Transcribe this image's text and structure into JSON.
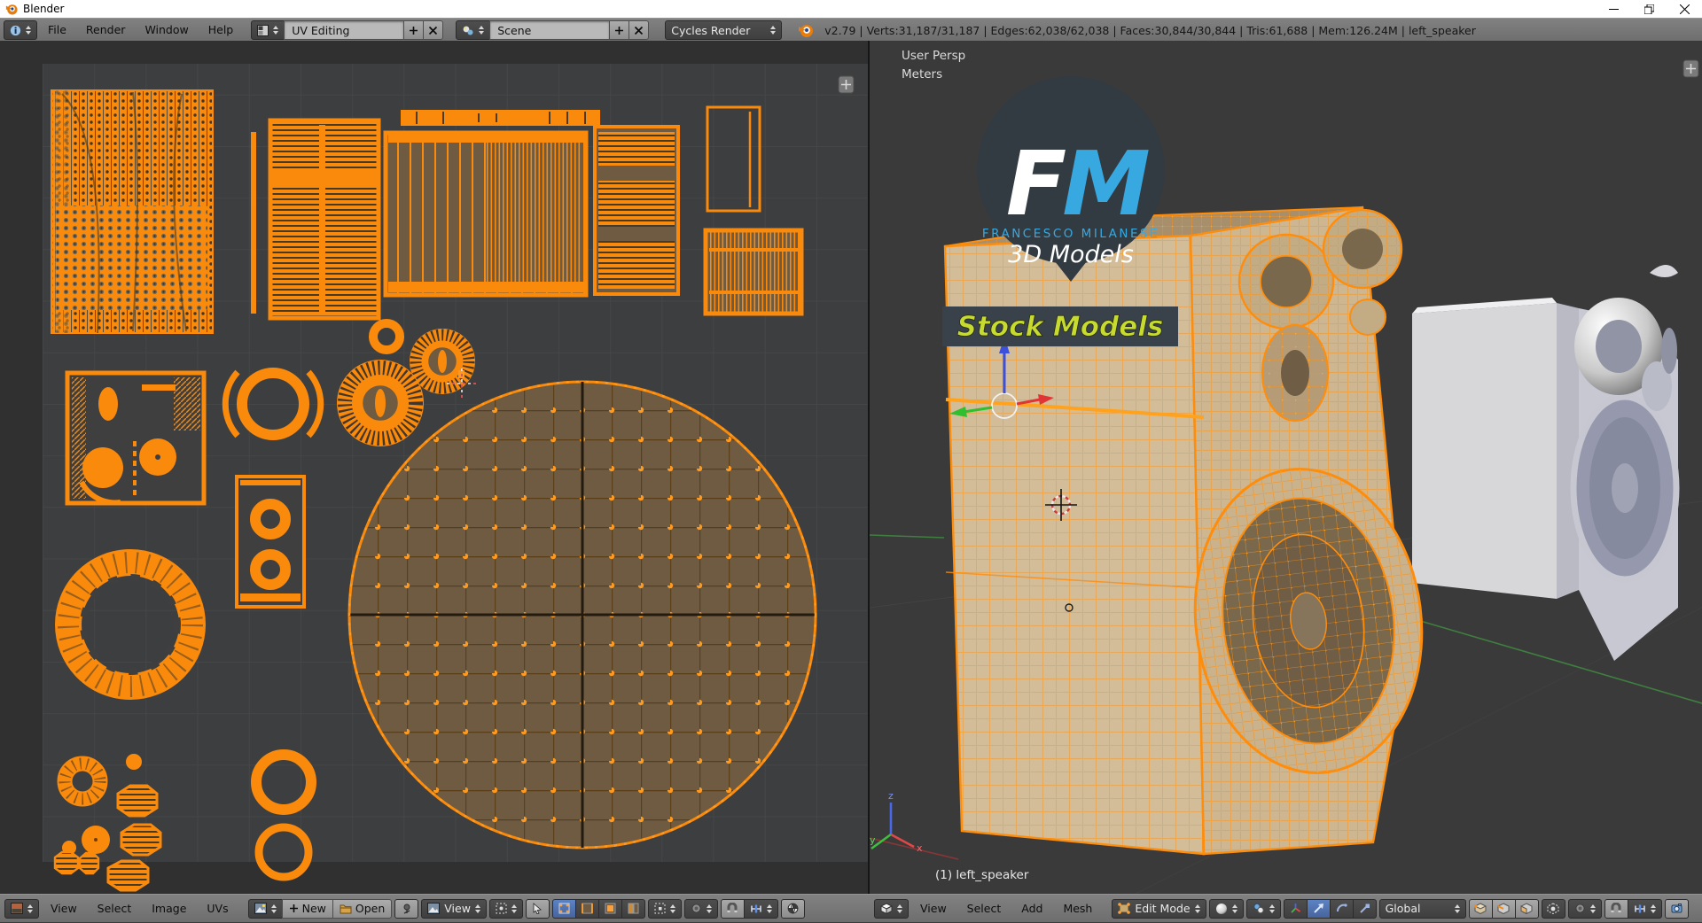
{
  "window": {
    "title": "Blender"
  },
  "topbar": {
    "menus": [
      "File",
      "Render",
      "Window",
      "Help"
    ],
    "layout_name": "UV Editing",
    "scene_name": "Scene",
    "engine": "Cycles Render",
    "stats": "v2.79 | Verts:31,187/31,187 | Edges:62,038/62,038 | Faces:30,844/30,844 | Tris:61,688 | Mem:126.24M | left_speaker"
  },
  "uv_editor": {
    "menus": [
      "View",
      "Select",
      "Image",
      "UVs"
    ],
    "new_label": "New",
    "open_label": "Open",
    "mode_label": "View"
  },
  "viewport": {
    "menus": [
      "View",
      "Select",
      "Add",
      "Mesh"
    ],
    "mode_label": "Edit Mode",
    "orientation_label": "Global",
    "view_name": "User Persp",
    "units": "Meters",
    "object_label": "(1) left_speaker",
    "axis": {
      "x": "x",
      "y": "y",
      "z": "z"
    }
  },
  "logo": {
    "f": "F",
    "m": "M",
    "line1": "FRANCESCO MILANESE",
    "line2": "3D Models",
    "banner": "Stock Models"
  },
  "colors": {
    "selection_orange": "#ff8c0a",
    "face_brown": "#6e5b41",
    "active_blue": "#4f74b3",
    "logo_blue": "#38a8e0",
    "banner_green": "#c6da2f"
  }
}
